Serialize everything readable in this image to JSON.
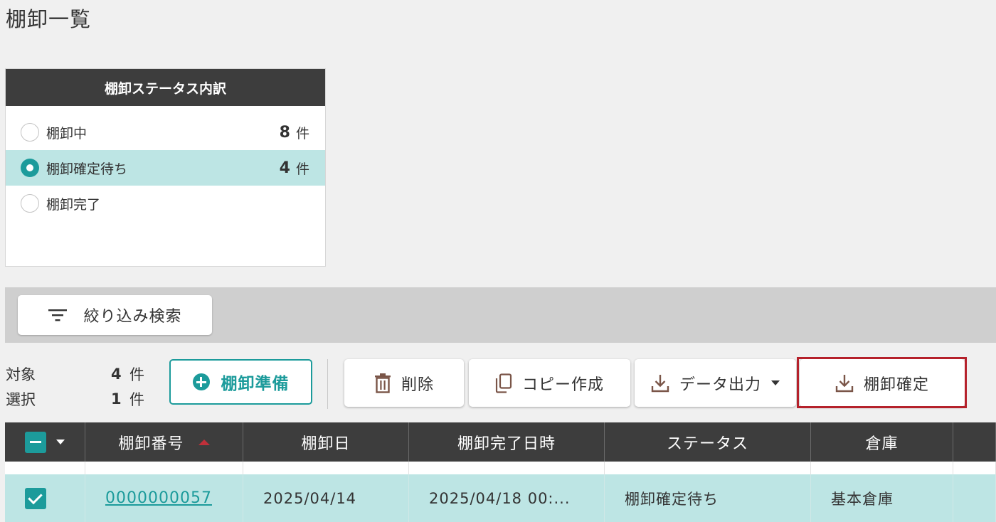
{
  "page": {
    "title": "棚卸一覧"
  },
  "status_panel": {
    "title": "棚卸ステータス内訳",
    "items": [
      {
        "label": "棚卸中",
        "count": "8",
        "unit": "件",
        "selected": false
      },
      {
        "label": "棚卸確定待ち",
        "count": "4",
        "unit": "件",
        "selected": true
      },
      {
        "label": "棚卸完了",
        "count": "",
        "unit": "",
        "selected": false
      }
    ]
  },
  "filter": {
    "label": "絞り込み検索",
    "icon": "filter-icon"
  },
  "counts": {
    "target_label": "対象",
    "target_count": "4",
    "target_unit": "件",
    "selected_label": "選択",
    "selected_count": "1",
    "selected_unit": "件"
  },
  "toolbar": {
    "prepare_label": "棚卸準備",
    "delete_label": "削除",
    "copy_label": "コピー作成",
    "export_label": "データ出力",
    "confirm_label": "棚卸確定"
  },
  "colors": {
    "accent": "#1c9b9b",
    "header_bg": "#3d3d3d",
    "selected_row": "#bde5e4",
    "highlight": "#b5212b"
  },
  "table": {
    "columns": [
      "棚卸番号",
      "棚卸日",
      "棚卸完了日時",
      "ステータス",
      "倉庫"
    ],
    "rows": [
      {
        "number": "0000000057",
        "date": "2025/04/14",
        "completed": "2025/04/18 00:...",
        "status": "棚卸確定待ち",
        "warehouse": "基本倉庫"
      }
    ]
  }
}
